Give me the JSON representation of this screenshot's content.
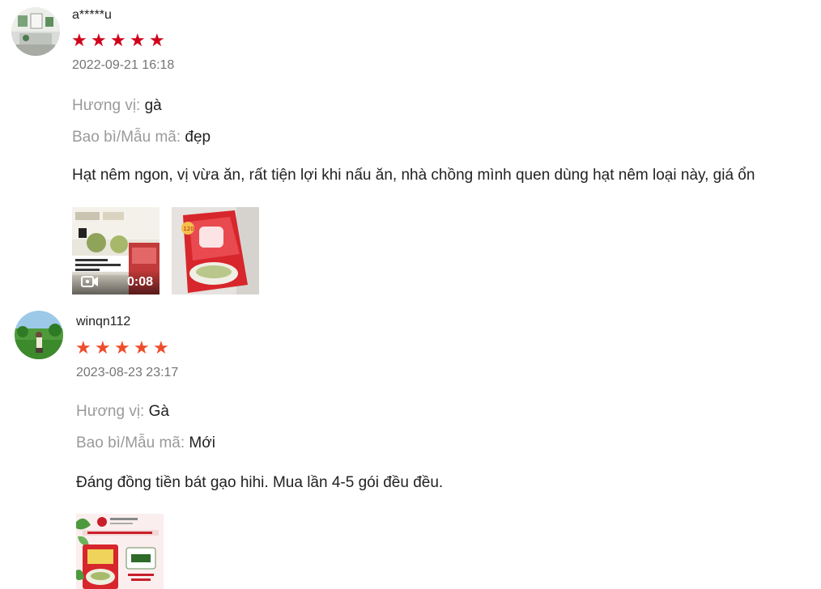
{
  "reviews": [
    {
      "username": "a*****u",
      "stars": [
        "★",
        "★",
        "★",
        "★",
        "★"
      ],
      "star_color": "#d0011b",
      "timestamp": "2022-09-21 16:18",
      "attributes": [
        {
          "label": "Hương vị:",
          "value": "gà"
        },
        {
          "label": "Bao bì/Mẫu mã:",
          "value": "đẹp"
        }
      ],
      "comment": "Hạt nêm ngon, vị vừa ăn, rất tiện lợi khi nấu ăn, nhà chồng mình quen dùng hạt nêm loại này, giá ổn",
      "media": [
        {
          "type": "video",
          "duration": "0:08",
          "icon": "video-camera-icon"
        },
        {
          "type": "image"
        }
      ]
    },
    {
      "username": "winqn112",
      "stars": [
        "★",
        "★",
        "★",
        "★",
        "★"
      ],
      "star_color": "#ee4d2d",
      "timestamp": "2023-08-23 23:17",
      "attributes": [
        {
          "label": "Hương vị:",
          "value": "Gà"
        },
        {
          "label": "Bao bì/Mẫu mã:",
          "value": "Mới"
        }
      ],
      "comment": "Đáng đồng tiền bát gạo hihi. Mua lần 4-5 gói đều đều.",
      "media": [
        {
          "type": "image"
        }
      ]
    }
  ]
}
